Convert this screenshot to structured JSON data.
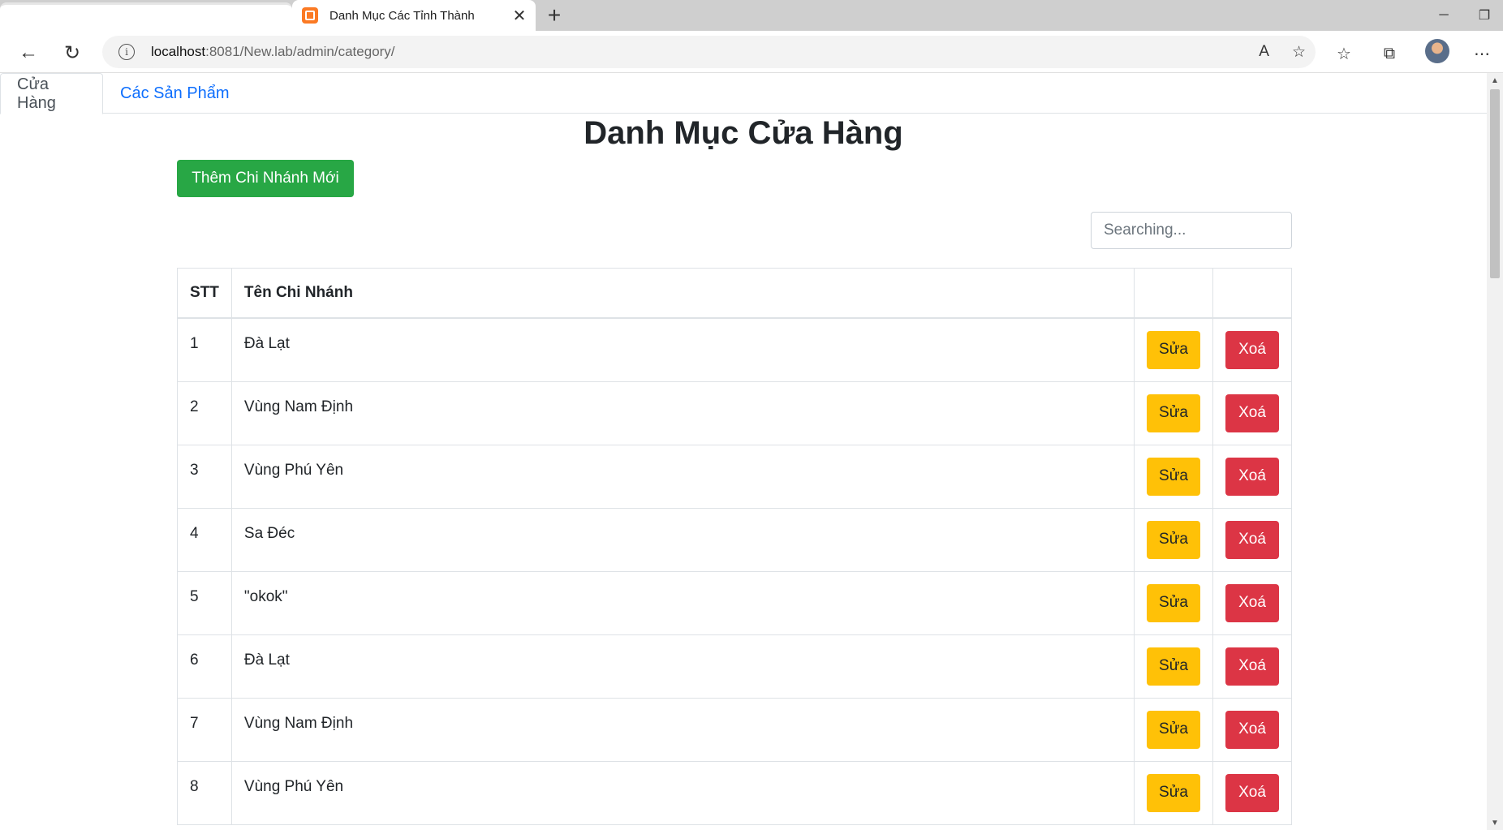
{
  "browser": {
    "tab_title": "Danh Mục Các Tỉnh Thành",
    "url_host": "localhost",
    "url_rest": ":8081/New.lab/admin/category/"
  },
  "nav": {
    "tabs": [
      "Cửa Hàng",
      "Các Sản Phẩm"
    ]
  },
  "page": {
    "title": "Danh Mục Cửa Hàng",
    "add_button": "Thêm Chi Nhánh Mới",
    "search_placeholder": "Searching..."
  },
  "table": {
    "headers": [
      "STT",
      "Tên Chi Nhánh",
      "",
      ""
    ],
    "edit_label": "Sửa",
    "delete_label": "Xoá",
    "rows": [
      {
        "stt": "1",
        "name": "Đà Lạt"
      },
      {
        "stt": "2",
        "name": "Vùng Nam Định"
      },
      {
        "stt": "3",
        "name": "Vùng Phú Yên"
      },
      {
        "stt": "4",
        "name": "Sa Đéc"
      },
      {
        "stt": "5",
        "name": "\"okok\""
      },
      {
        "stt": "6",
        "name": "Đà Lạt"
      },
      {
        "stt": "7",
        "name": "Vùng Nam Định"
      },
      {
        "stt": "8",
        "name": "Vùng Phú Yên"
      }
    ]
  },
  "colors": {
    "success": "#28a745",
    "warning": "#ffc107",
    "danger": "#dc3545",
    "link": "#0d6efd"
  }
}
